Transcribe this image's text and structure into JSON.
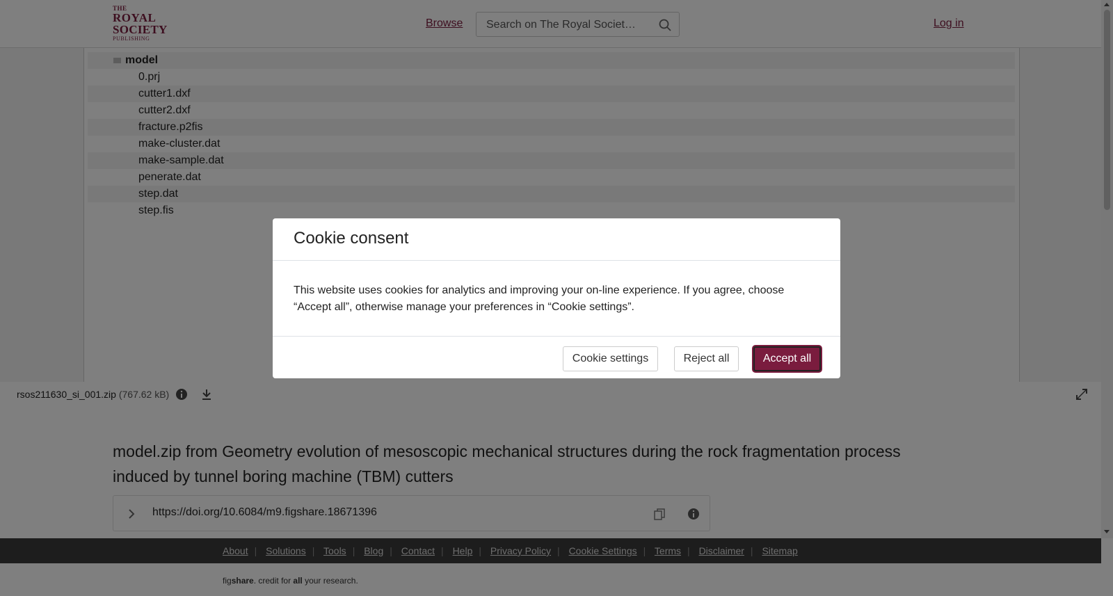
{
  "header": {
    "logo": {
      "the": "THE",
      "royal": "ROYAL",
      "society": "SOCIETY",
      "publishing": "PUBLISHING"
    },
    "browse_label": "Browse",
    "search_placeholder": "Search on The Royal Societ…",
    "login_label": "Log in"
  },
  "file_tree": {
    "folder": "model",
    "files": [
      "0.prj",
      "cutter1.dxf",
      "cutter2.dxf",
      "fracture.p2fis",
      "make-cluster.dat",
      "make-sample.dat",
      "penerate.dat",
      "step.dat",
      "step.fis"
    ]
  },
  "file_bar": {
    "filename": "rsos211630_si_001.zip",
    "size": "(767.62 kB)"
  },
  "main": {
    "title": "model.zip from Geometry evolution of mesoscopic mechanical structures during the rock fragmentation process induced by tunnel boring machine (TBM) cutters",
    "doi": "https://doi.org/10.6084/m9.figshare.18671396"
  },
  "footer": {
    "links": [
      "About",
      "Solutions",
      "Tools",
      "Blog",
      "Contact",
      "Help",
      "Privacy Policy",
      "Cookie Settings",
      "Terms",
      "Disclaimer",
      "Sitemap"
    ],
    "credit": {
      "fig": "fig",
      "share": "share",
      "middle": ". credit for ",
      "all": "all",
      "end": " your research."
    }
  },
  "cookie_modal": {
    "title": "Cookie consent",
    "body": "This website uses cookies for analytics and improving your on-line experience. If you agree, choose “Accept all”, otherwise manage your preferences in “Cookie settings”.",
    "settings_label": "Cookie settings",
    "reject_label": "Reject all",
    "accept_label": "Accept all"
  },
  "colors": {
    "brand": "#7a1c3e",
    "footer_bg": "#3a3a3a"
  }
}
